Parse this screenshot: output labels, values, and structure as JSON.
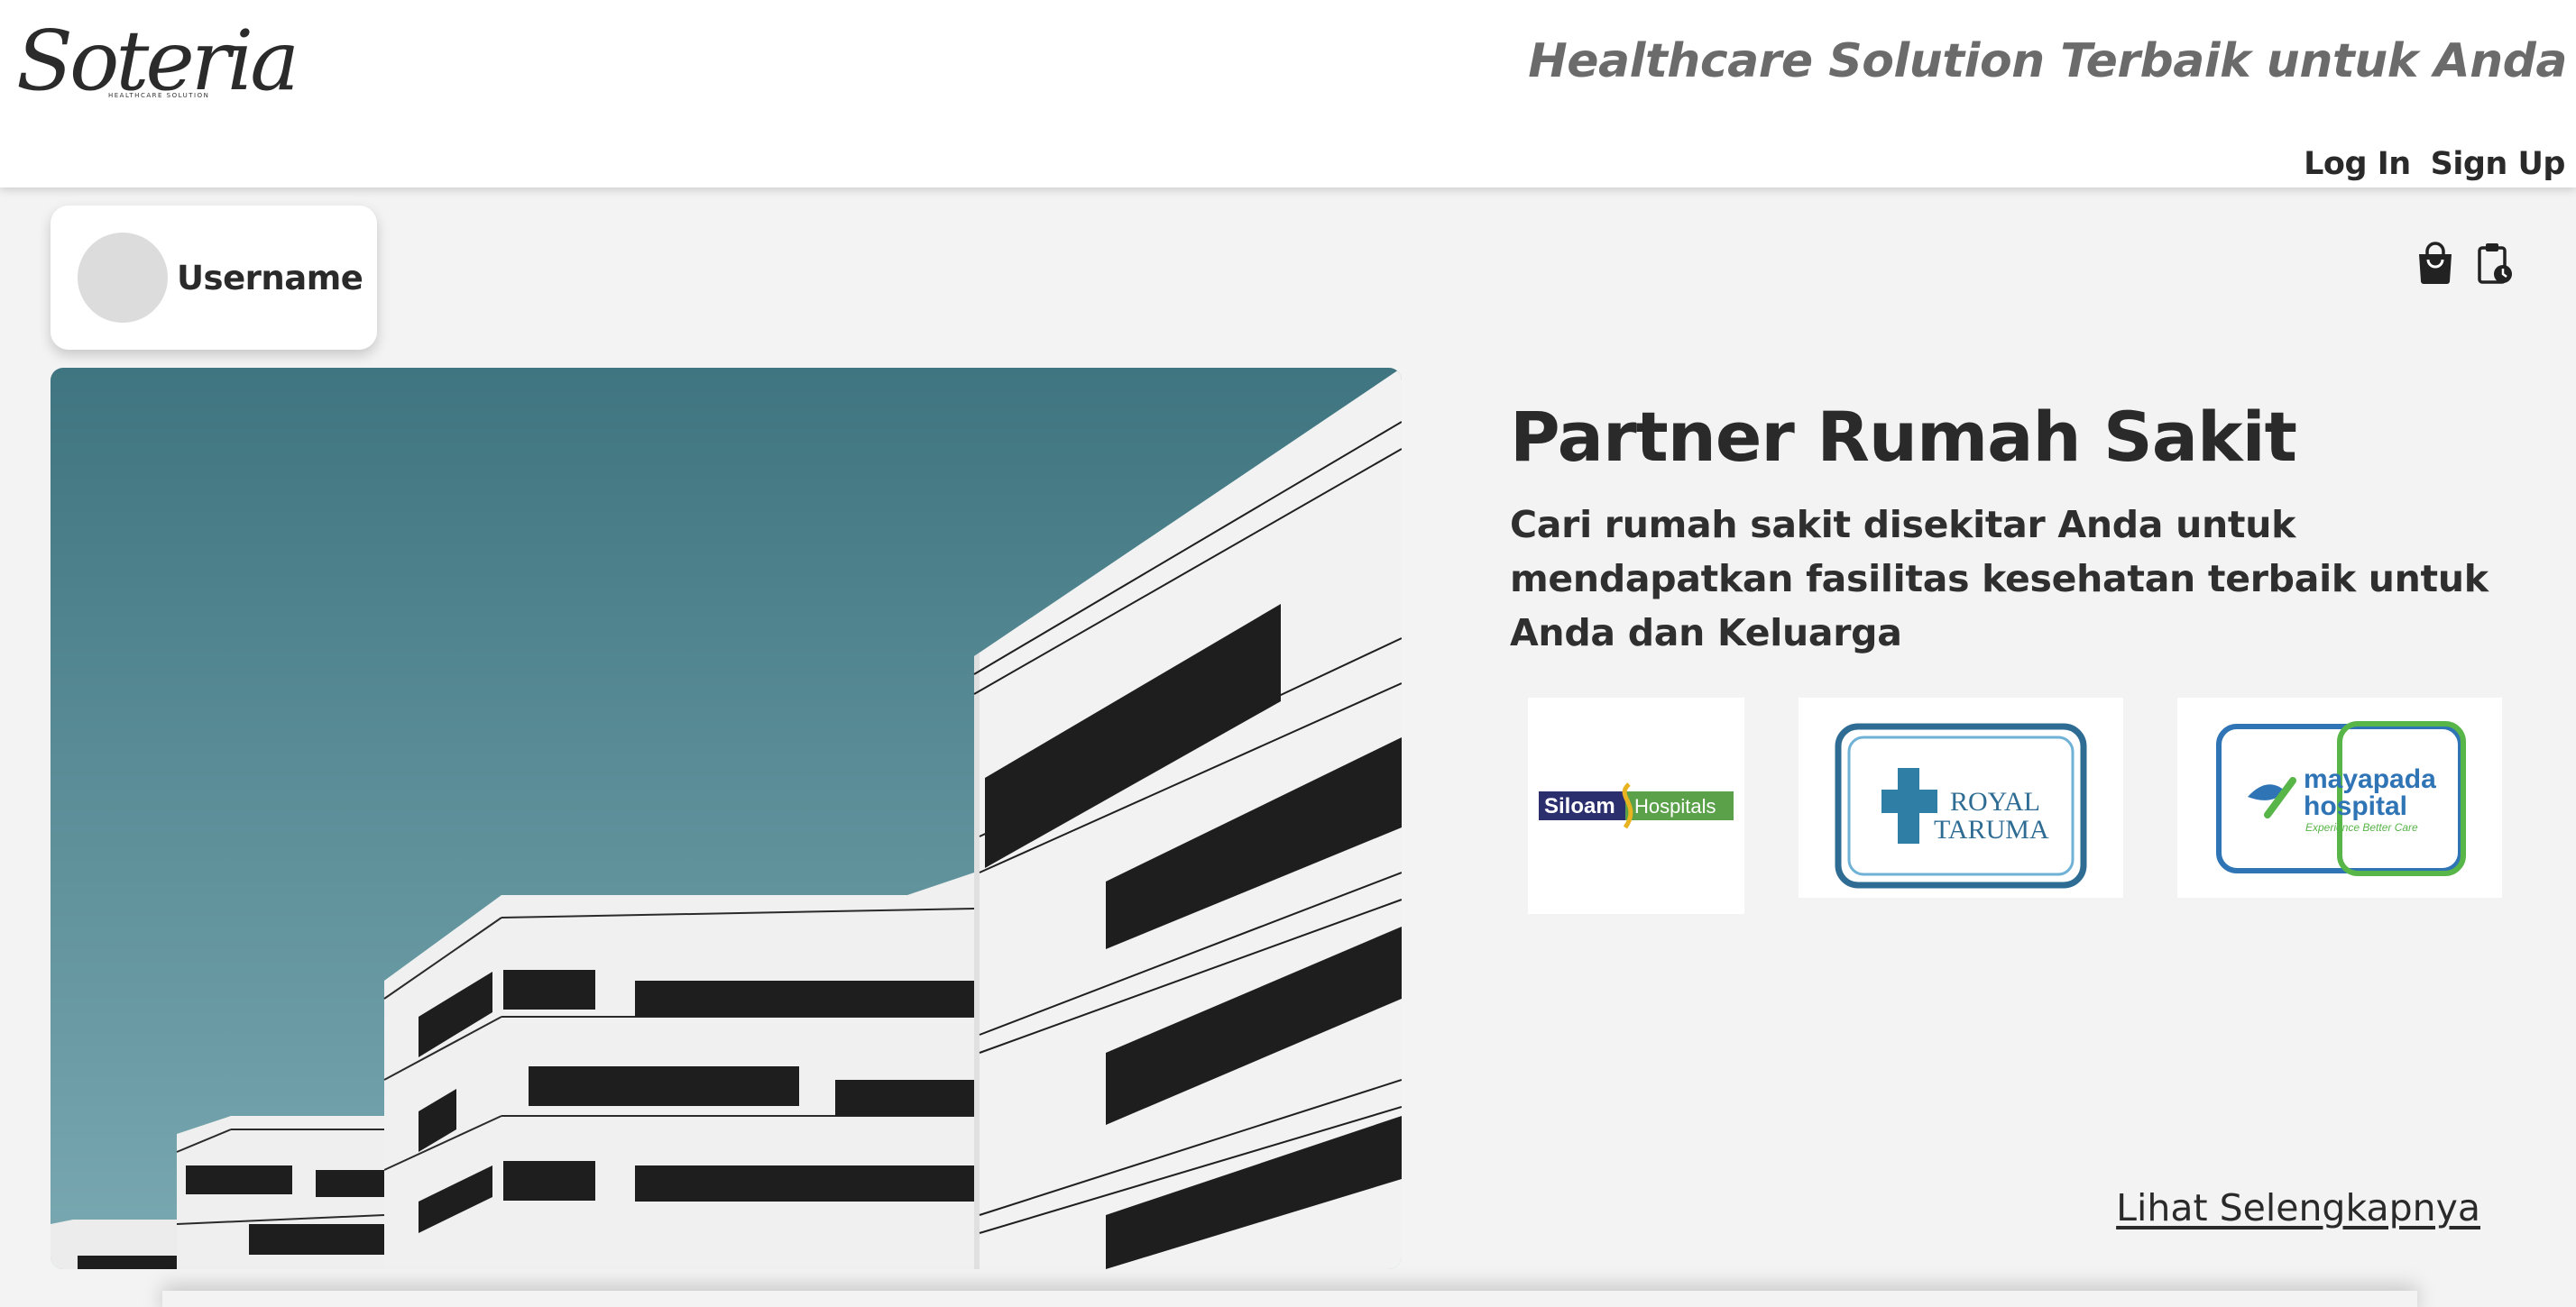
{
  "header": {
    "logo_text": "Soteria",
    "logo_subtext": "HEALTHCARE SOLUTION",
    "tagline": "Healthcare Solution Terbaik untuk Anda",
    "login_label": "Log In",
    "signup_label": "Sign Up"
  },
  "user": {
    "name": "Username"
  },
  "icons": {
    "cart": "shopping-bag-icon",
    "history": "clipboard-clock-icon"
  },
  "section": {
    "title": "Partner Rumah Sakit",
    "description": "Cari rumah sakit disekitar Anda untuk mendapatkan fasilitas kesehatan terbaik untuk Anda dan Keluarga",
    "see_more": "Lihat Selengkapnya"
  },
  "partners": [
    {
      "name": "Siloam",
      "name2": "Hospitals"
    },
    {
      "name": "ROYAL",
      "name2": "TARUMA"
    },
    {
      "name": "mayapada",
      "name2": "hospital",
      "tagline": "Experience Better Care"
    }
  ],
  "colors": {
    "page_bg": "#f3f3f3",
    "header_bg": "#ffffff",
    "text_dark": "#2a2a2a",
    "tagline_gray": "#6b6b6b",
    "sky_top": "#3f7580",
    "sky_bottom": "#7aa9b2"
  }
}
